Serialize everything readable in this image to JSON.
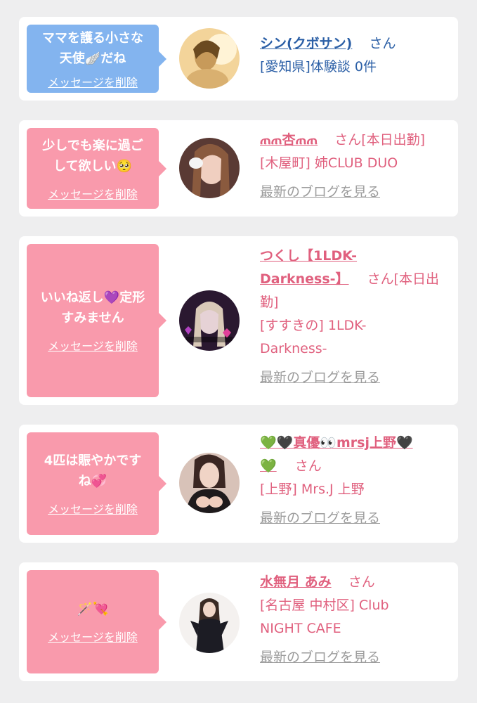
{
  "cards": [
    {
      "bubble_lines": [
        "ママを護る小さな",
        "天使🪽だね"
      ],
      "delete_label": "メッセージを削除",
      "name": "シン(クボサン)",
      "honorific": "さん",
      "shop_lines": [
        "[愛知県]体験談 0件"
      ],
      "blog_label": ""
    },
    {
      "bubble_lines": [
        "少しでも楽に過ご",
        "して欲しい🥺"
      ],
      "delete_label": "メッセージを削除",
      "name": "ጠጠ杏ጠጠ",
      "honorific": "さん[本日出勤]",
      "shop_lines": [
        "[木屋町] 姉CLUB DUO"
      ],
      "blog_label": "最新のブログを見る"
    },
    {
      "bubble_lines": [
        "いいね返し💜定形",
        "すみません"
      ],
      "delete_label": "メッセージを削除",
      "name_lines": [
        "つくし【1LDK-",
        "Darkness-】"
      ],
      "honorific": "さん[本日出",
      "honorific_cont": "勤]",
      "shop_lines": [
        "[すすきの] 1LDK-",
        "Darkness-"
      ],
      "blog_label": "最新のブログを見る"
    },
    {
      "bubble_lines": [
        "4匹は賑やかです",
        "ね💞"
      ],
      "delete_label": "メッセージを削除",
      "name_lines": [
        "💚🖤真優👀mrsj上野🖤",
        "💚"
      ],
      "honorific": "さん",
      "shop_lines": [
        "[上野] Mrs.J 上野"
      ],
      "blog_label": "最新のブログを見る"
    },
    {
      "bubble_lines": [
        "🪄💘"
      ],
      "delete_label": "メッセージを削除",
      "name": "水無月 あみ",
      "honorific": "さん",
      "shop_lines": [
        "[名古屋 中村区] Club",
        "NIGHT CAFE"
      ],
      "blog_label": "最新のブログを見る"
    }
  ],
  "colors": {
    "background": "#eeeeef",
    "bubble_blue": "#83b4ef",
    "bubble_pink": "#f99aac",
    "text_pink": "#e0607e",
    "text_blue": "#2b5fa6",
    "link_gray": "#9c9c9c"
  }
}
